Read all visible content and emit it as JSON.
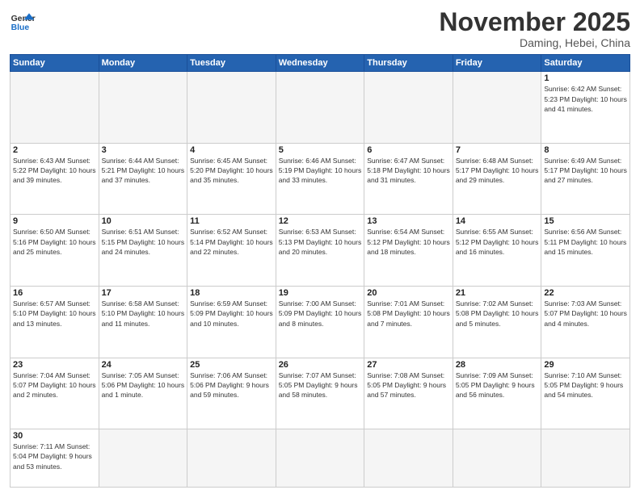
{
  "logo": {
    "general": "General",
    "blue": "Blue"
  },
  "header": {
    "month": "November 2025",
    "location": "Daming, Hebei, China"
  },
  "days_of_week": [
    "Sunday",
    "Monday",
    "Tuesday",
    "Wednesday",
    "Thursday",
    "Friday",
    "Saturday"
  ],
  "weeks": [
    [
      {
        "day": "",
        "info": ""
      },
      {
        "day": "",
        "info": ""
      },
      {
        "day": "",
        "info": ""
      },
      {
        "day": "",
        "info": ""
      },
      {
        "day": "",
        "info": ""
      },
      {
        "day": "",
        "info": ""
      },
      {
        "day": "1",
        "info": "Sunrise: 6:42 AM\nSunset: 5:23 PM\nDaylight: 10 hours\nand 41 minutes."
      }
    ],
    [
      {
        "day": "2",
        "info": "Sunrise: 6:43 AM\nSunset: 5:22 PM\nDaylight: 10 hours\nand 39 minutes."
      },
      {
        "day": "3",
        "info": "Sunrise: 6:44 AM\nSunset: 5:21 PM\nDaylight: 10 hours\nand 37 minutes."
      },
      {
        "day": "4",
        "info": "Sunrise: 6:45 AM\nSunset: 5:20 PM\nDaylight: 10 hours\nand 35 minutes."
      },
      {
        "day": "5",
        "info": "Sunrise: 6:46 AM\nSunset: 5:19 PM\nDaylight: 10 hours\nand 33 minutes."
      },
      {
        "day": "6",
        "info": "Sunrise: 6:47 AM\nSunset: 5:18 PM\nDaylight: 10 hours\nand 31 minutes."
      },
      {
        "day": "7",
        "info": "Sunrise: 6:48 AM\nSunset: 5:17 PM\nDaylight: 10 hours\nand 29 minutes."
      },
      {
        "day": "8",
        "info": "Sunrise: 6:49 AM\nSunset: 5:17 PM\nDaylight: 10 hours\nand 27 minutes."
      }
    ],
    [
      {
        "day": "9",
        "info": "Sunrise: 6:50 AM\nSunset: 5:16 PM\nDaylight: 10 hours\nand 25 minutes."
      },
      {
        "day": "10",
        "info": "Sunrise: 6:51 AM\nSunset: 5:15 PM\nDaylight: 10 hours\nand 24 minutes."
      },
      {
        "day": "11",
        "info": "Sunrise: 6:52 AM\nSunset: 5:14 PM\nDaylight: 10 hours\nand 22 minutes."
      },
      {
        "day": "12",
        "info": "Sunrise: 6:53 AM\nSunset: 5:13 PM\nDaylight: 10 hours\nand 20 minutes."
      },
      {
        "day": "13",
        "info": "Sunrise: 6:54 AM\nSunset: 5:12 PM\nDaylight: 10 hours\nand 18 minutes."
      },
      {
        "day": "14",
        "info": "Sunrise: 6:55 AM\nSunset: 5:12 PM\nDaylight: 10 hours\nand 16 minutes."
      },
      {
        "day": "15",
        "info": "Sunrise: 6:56 AM\nSunset: 5:11 PM\nDaylight: 10 hours\nand 15 minutes."
      }
    ],
    [
      {
        "day": "16",
        "info": "Sunrise: 6:57 AM\nSunset: 5:10 PM\nDaylight: 10 hours\nand 13 minutes."
      },
      {
        "day": "17",
        "info": "Sunrise: 6:58 AM\nSunset: 5:10 PM\nDaylight: 10 hours\nand 11 minutes."
      },
      {
        "day": "18",
        "info": "Sunrise: 6:59 AM\nSunset: 5:09 PM\nDaylight: 10 hours\nand 10 minutes."
      },
      {
        "day": "19",
        "info": "Sunrise: 7:00 AM\nSunset: 5:09 PM\nDaylight: 10 hours\nand 8 minutes."
      },
      {
        "day": "20",
        "info": "Sunrise: 7:01 AM\nSunset: 5:08 PM\nDaylight: 10 hours\nand 7 minutes."
      },
      {
        "day": "21",
        "info": "Sunrise: 7:02 AM\nSunset: 5:08 PM\nDaylight: 10 hours\nand 5 minutes."
      },
      {
        "day": "22",
        "info": "Sunrise: 7:03 AM\nSunset: 5:07 PM\nDaylight: 10 hours\nand 4 minutes."
      }
    ],
    [
      {
        "day": "23",
        "info": "Sunrise: 7:04 AM\nSunset: 5:07 PM\nDaylight: 10 hours\nand 2 minutes."
      },
      {
        "day": "24",
        "info": "Sunrise: 7:05 AM\nSunset: 5:06 PM\nDaylight: 10 hours\nand 1 minute."
      },
      {
        "day": "25",
        "info": "Sunrise: 7:06 AM\nSunset: 5:06 PM\nDaylight: 9 hours\nand 59 minutes."
      },
      {
        "day": "26",
        "info": "Sunrise: 7:07 AM\nSunset: 5:05 PM\nDaylight: 9 hours\nand 58 minutes."
      },
      {
        "day": "27",
        "info": "Sunrise: 7:08 AM\nSunset: 5:05 PM\nDaylight: 9 hours\nand 57 minutes."
      },
      {
        "day": "28",
        "info": "Sunrise: 7:09 AM\nSunset: 5:05 PM\nDaylight: 9 hours\nand 56 minutes."
      },
      {
        "day": "29",
        "info": "Sunrise: 7:10 AM\nSunset: 5:05 PM\nDaylight: 9 hours\nand 54 minutes."
      }
    ],
    [
      {
        "day": "30",
        "info": "Sunrise: 7:11 AM\nSunset: 5:04 PM\nDaylight: 9 hours\nand 53 minutes."
      },
      {
        "day": "",
        "info": ""
      },
      {
        "day": "",
        "info": ""
      },
      {
        "day": "",
        "info": ""
      },
      {
        "day": "",
        "info": ""
      },
      {
        "day": "",
        "info": ""
      },
      {
        "day": "",
        "info": ""
      }
    ]
  ]
}
